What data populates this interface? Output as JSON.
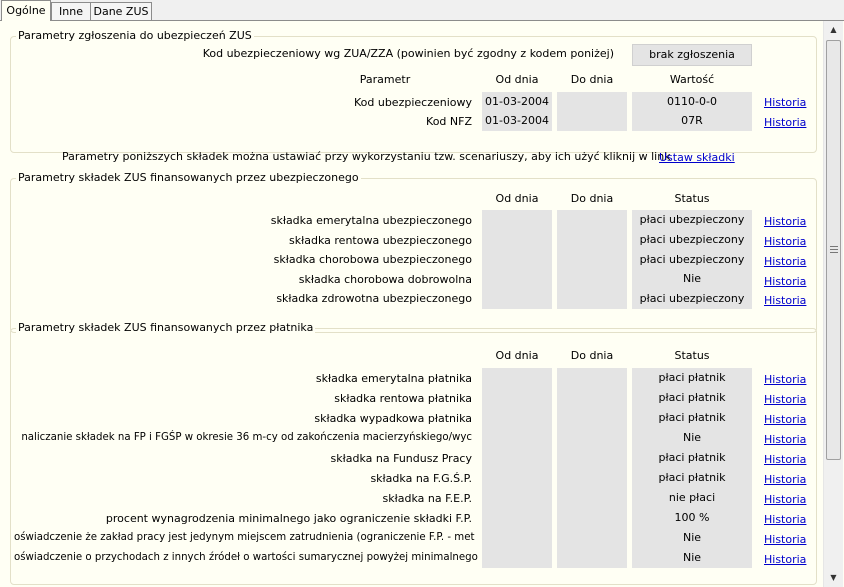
{
  "tabs": [
    "Ogólne",
    "Inne",
    "Dane ZUS"
  ],
  "g1": {
    "title": "Parametry zgłoszenia do ubezpieczeń ZUS",
    "kod_label": "Kod ubezpieczeniowy wg ZUA/ZZA (powinien być zgodny z kodem poniżej)",
    "kod_button": "brak zgłoszenia",
    "headers": {
      "param": "Parametr",
      "od": "Od dnia",
      "do": "Do dnia",
      "val": "Wartość"
    },
    "rows": [
      {
        "label": "Kod ubezpieczeniowy",
        "od": "01-03-2004",
        "do": "",
        "val": "0110-0-0",
        "link": "Historia"
      },
      {
        "label": "Kod NFZ",
        "od": "01-03-2004",
        "do": "",
        "val": "07R",
        "link": "Historia"
      }
    ]
  },
  "info": {
    "text": "Parametry poniższych składek można ustawiać przy wykorzystaniu tzw. scenariuszy, aby ich użyć kliknij w link",
    "link": "Ustaw składki"
  },
  "g2": {
    "title": "Parametry składek ZUS finansowanych przez ubezpieczonego",
    "headers": {
      "od": "Od dnia",
      "do": "Do dnia",
      "status": "Status"
    },
    "rows": [
      {
        "label": "składka emerytalna ubezpieczonego",
        "status": "płaci ubezpieczony",
        "link": "Historia"
      },
      {
        "label": "składka rentowa ubezpieczonego",
        "status": "płaci ubezpieczony",
        "link": "Historia"
      },
      {
        "label": "składka chorobowa ubezpieczonego",
        "status": "płaci ubezpieczony",
        "link": "Historia"
      },
      {
        "label": "składka chorobowa dobrowolna",
        "status": "Nie",
        "link": "Historia"
      },
      {
        "label": "składka zdrowotna ubezpieczonego",
        "status": "płaci ubezpieczony",
        "link": "Historia"
      }
    ]
  },
  "g3": {
    "title": "Parametry składek ZUS finansowanych przez płatnika",
    "headers": {
      "od": "Od dnia",
      "do": "Do dnia",
      "status": "Status"
    },
    "rows": [
      {
        "label": "składka emerytalna płatnika",
        "status": "płaci płatnik",
        "link": "Historia"
      },
      {
        "label": "składka rentowa płatnika",
        "status": "płaci płatnik",
        "link": "Historia"
      },
      {
        "label": "składka wypadkowa płatnika",
        "status": "płaci płatnik",
        "link": "Historia"
      },
      {
        "label": "naliczanie składek na FP i FGŚP w okresie 36 m-cy od zakończenia macierzyńskiego/wyc",
        "status": "Nie",
        "link": "Historia"
      },
      {
        "label": "składka na Fundusz Pracy",
        "status": "płaci płatnik",
        "link": "Historia"
      },
      {
        "label": "składka na F.G.Ś.P.",
        "status": "płaci płatnik",
        "link": "Historia"
      },
      {
        "label": "składka na F.E.P.",
        "status": "nie płaci",
        "link": "Historia"
      },
      {
        "label": "procent wynagrodzenia minimalnego jako ograniczenie składki F.P.",
        "status": "100 %",
        "link": "Historia"
      },
      {
        "label": "oświadczenie że zakład pracy jest jedynym miejscem zatrudnienia (ograniczenie F.P. - met",
        "status": "Nie",
        "link": "Historia"
      },
      {
        "label": "oświadczenie o przychodach z innych źródeł o wartości sumarycznej powyżej minimalnego",
        "status": "Nie",
        "link": "Historia"
      }
    ]
  },
  "scrollbar": {
    "up_icon": "triangle-up",
    "down_icon": "triangle-down"
  }
}
